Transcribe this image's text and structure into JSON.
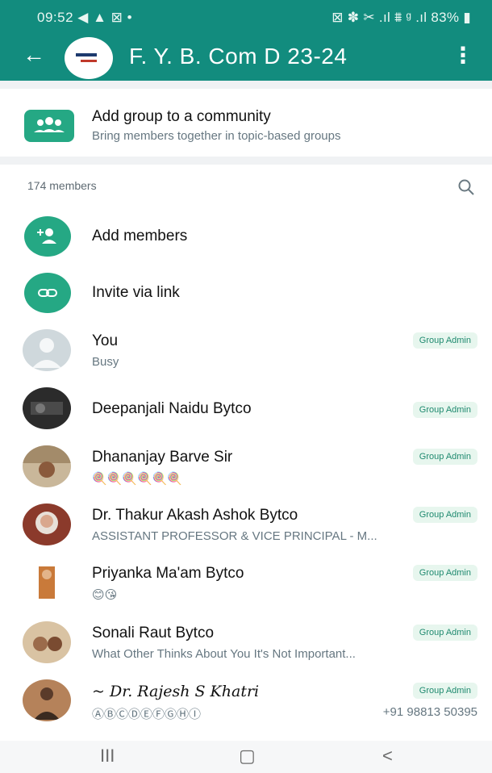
{
  "status_bar": {
    "time": "09:52",
    "left_icons": "◀ ▲ ⊠ •",
    "right_icons": "⊠ ✽ ✂ .ıl ⩩ ᵍ .ıl",
    "battery": "83%"
  },
  "app_bar": {
    "back_icon": "arrow-left-icon",
    "title": "F. Y. B. Com D 23-24",
    "menu_icon": "more-vert-icon"
  },
  "community": {
    "title": "Add group to a community",
    "subtitle": "Bring members together in topic-based groups"
  },
  "members": {
    "count_label": "174 members"
  },
  "actions": [
    {
      "label": "Add members",
      "icon": "person-add-icon"
    },
    {
      "label": "Invite via link",
      "icon": "link-icon"
    }
  ],
  "member_list": [
    {
      "name": "You",
      "status": "Busy",
      "badge": "Group Admin",
      "phone": ""
    },
    {
      "name": "Deepanjali Naidu Bytco",
      "status": "",
      "badge": "Group Admin",
      "phone": ""
    },
    {
      "name": "Dhananjay Barve Sir",
      "status": "🍭🍭🍭🍭🍭🍭",
      "badge": "Group Admin",
      "phone": ""
    },
    {
      "name": "Dr. Thakur Akash Ashok Bytco",
      "status": "ASSISTANT PROFESSOR & VICE PRINCIPAL - M...",
      "badge": "Group Admin",
      "phone": ""
    },
    {
      "name": "Priyanka Ma'am Bytco",
      "status": "😊😘",
      "badge": "Group Admin",
      "phone": ""
    },
    {
      "name": "Sonali Raut Bytco",
      "status": "What Other Thinks About You It's Not Important...",
      "badge": "Group Admin",
      "phone": ""
    },
    {
      "name": "~ Dr. Rajesh S Khatri",
      "status": "ⒶⒷⒸⒹⒺⒻⒼⒽⒾ",
      "badge": "Group Admin",
      "phone": "+91 98813 50395"
    }
  ],
  "nav_bar": {
    "recent": "III",
    "home": "▢",
    "back": "<"
  },
  "colors": {
    "header": "#128C7E",
    "accent": "#25A884",
    "badge_bg": "#e7f6ee",
    "badge_text": "#1f8a6f"
  }
}
